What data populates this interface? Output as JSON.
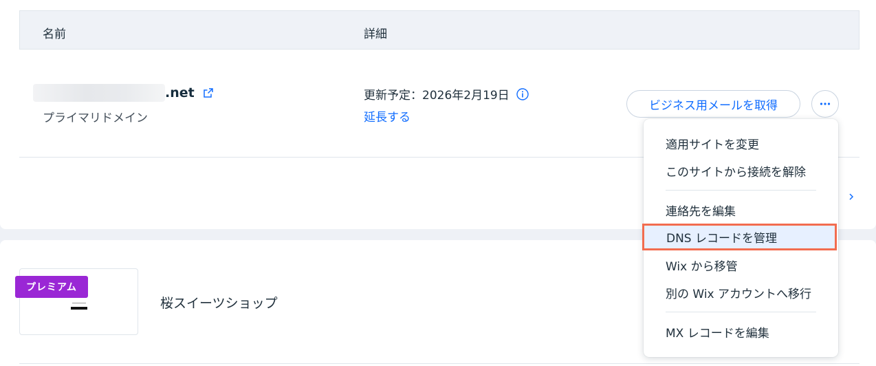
{
  "table": {
    "col_name": "名前",
    "col_details": "詳細"
  },
  "domain": {
    "tld": ".net",
    "subtitle": "プライマリドメイン",
    "renewal": "更新予定：2026年2月19日",
    "extend_link": "延長する",
    "email_button": "ビジネス用メールを取得"
  },
  "menu": {
    "items": [
      "適用サイトを変更",
      "このサイトから接続を解除",
      "連絡先を編集",
      "DNS レコードを管理",
      "Wix から移管",
      "別の Wix アカウントへ移行",
      "MX レコードを編集"
    ],
    "highlighted_index": 3
  },
  "site": {
    "badge": "プレミアム",
    "name": "桜スイーツショップ"
  },
  "colors": {
    "accent": "#116dff",
    "premium": "#9a27d5",
    "highlight_border": "#f26c4f"
  }
}
